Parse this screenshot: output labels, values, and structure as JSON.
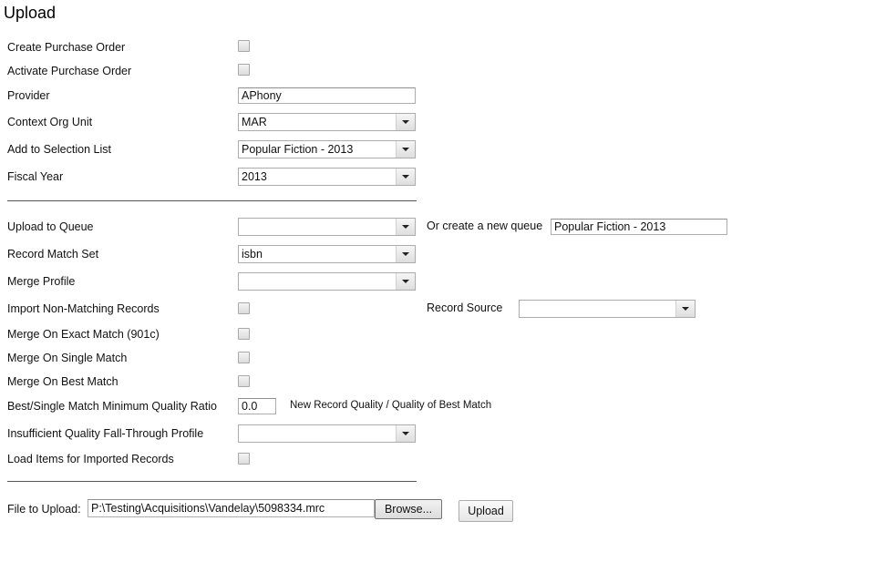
{
  "title": "Upload",
  "purchase": {
    "create_po_label": "Create Purchase Order",
    "create_po_checked": false,
    "activate_po_label": "Activate Purchase Order",
    "activate_po_checked": false,
    "provider_label": "Provider",
    "provider_value": "APhony",
    "context_org_label": "Context Org Unit",
    "context_org_value": "MAR",
    "selection_list_label": "Add to Selection List",
    "selection_list_value": "Popular Fiction - 2013",
    "fiscal_year_label": "Fiscal Year",
    "fiscal_year_value": "2013"
  },
  "queue": {
    "upload_queue_label": "Upload to Queue",
    "upload_queue_value": "",
    "new_queue_label": "Or create a new queue",
    "new_queue_value": "Popular Fiction - 2013",
    "match_set_label": "Record Match Set",
    "match_set_value": "isbn",
    "merge_profile_label": "Merge Profile",
    "merge_profile_value": "",
    "import_non_matching_label": "Import Non-Matching Records",
    "import_non_matching_checked": false,
    "record_source_label": "Record Source",
    "record_source_value": "",
    "merge_exact_label": "Merge On Exact Match (901c)",
    "merge_exact_checked": false,
    "merge_single_label": "Merge On Single Match",
    "merge_single_checked": false,
    "merge_best_label": "Merge On Best Match",
    "merge_best_checked": false,
    "quality_ratio_label": "Best/Single Match Minimum Quality Ratio",
    "quality_ratio_value": "0.0",
    "quality_ratio_hint": "New Record Quality / Quality of Best Match",
    "fallthrough_label": "Insufficient Quality Fall-Through Profile",
    "fallthrough_value": "",
    "load_items_label": "Load Items for Imported Records",
    "load_items_checked": false
  },
  "file": {
    "label": "File to Upload:",
    "value": "P:\\Testing\\Acquisitions\\Vandelay\\5098334.mrc",
    "browse_label": "Browse...",
    "upload_label": "Upload"
  }
}
